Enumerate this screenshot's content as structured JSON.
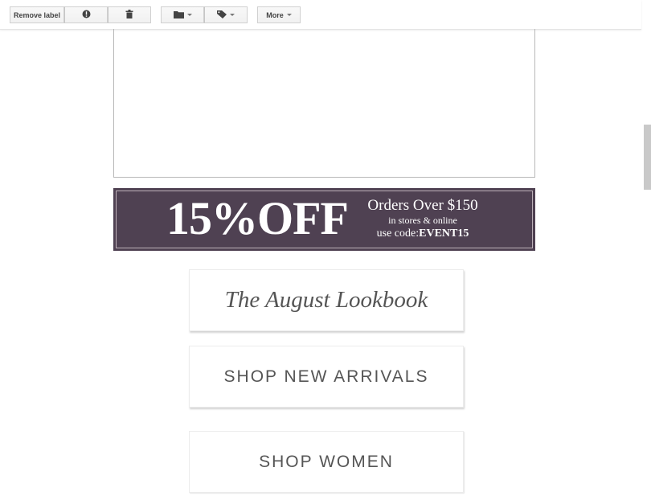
{
  "toolbar": {
    "remove_label": "Remove label",
    "report_spam_icon": "exclamation-icon",
    "delete_icon": "trash-icon",
    "move_to_icon": "folder-icon",
    "labels_icon": "tag-icon",
    "more_label": "More"
  },
  "email": {
    "promo": {
      "discount": "15%OFF",
      "line1": "Orders Over $150",
      "line2": "in stores & online",
      "code_prefix": "use code:",
      "code": "EVENT15",
      "background_color": "#4f4152"
    },
    "buttons": {
      "lookbook": "The August Lookbook",
      "new_arrivals": "SHOP NEW ARRIVALS",
      "women": "SHOP WOMEN"
    }
  }
}
